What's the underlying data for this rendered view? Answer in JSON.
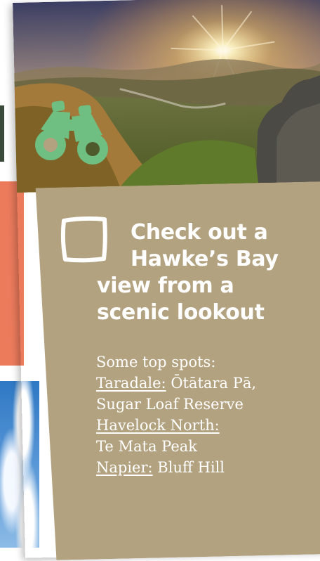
{
  "heading": {
    "line1": "Check out a",
    "line2": "Hawke’s Bay",
    "line3": "view from a",
    "line4": "scenic lookout"
  },
  "intro": "Some top spots:",
  "spots": [
    {
      "place": "Taradale:",
      "detail": "Ōtātara Pā,",
      "detail2": "Sugar Loaf Reserve"
    },
    {
      "place": "Havelock North:",
      "detail": "Te Mata Peak"
    },
    {
      "place": "Napier:",
      "detail": "Bluff Hill"
    }
  ],
  "colors": {
    "panel": "#b3a27f",
    "binoculars": "#6fbf82",
    "coral_edge": "#ec7b5c"
  },
  "icons": {
    "lookout": "binoculars-icon",
    "checkbox": "checkbox-icon"
  }
}
